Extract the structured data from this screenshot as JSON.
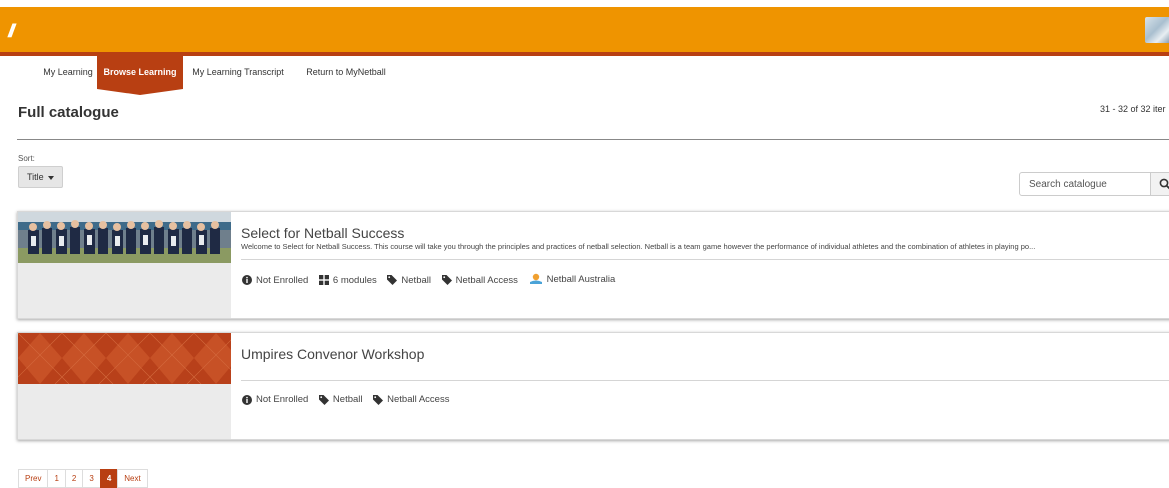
{
  "header": {
    "logo": "//"
  },
  "nav": {
    "items": [
      {
        "label": "My Learning"
      },
      {
        "label": "Browse Learning"
      },
      {
        "label": "My Learning Transcript"
      },
      {
        "label": "Return to MyNetball"
      }
    ],
    "active": "Browse Learning"
  },
  "page": {
    "title": "Full catalogue",
    "item_count": "31 - 32 of 32 iter"
  },
  "sort": {
    "label": "Sort:",
    "value": "Title"
  },
  "search": {
    "placeholder": "Search catalogue"
  },
  "cards": [
    {
      "title": "Select for Netball Success",
      "description": "Welcome to Select for Netball Success. This course will take you through the principles and practices of netball selection. Netball is a team game however the performance of individual athletes and the combination of athletes in playing po...",
      "status": "Not Enrolled",
      "modules": "6 modules",
      "tags": [
        "Netball",
        "Netball Access"
      ],
      "provider": "Netball Australia"
    },
    {
      "title": "Umpires Convenor Workshop",
      "status": "Not Enrolled",
      "tags": [
        "Netball",
        "Netball Access"
      ]
    }
  ],
  "pagination": {
    "prev": "Prev",
    "pages": [
      "1",
      "2",
      "3",
      "4"
    ],
    "current": "4",
    "next": "Next"
  },
  "colors": {
    "header_orange": "#ef9400",
    "accent_rust": "#b83f12"
  }
}
